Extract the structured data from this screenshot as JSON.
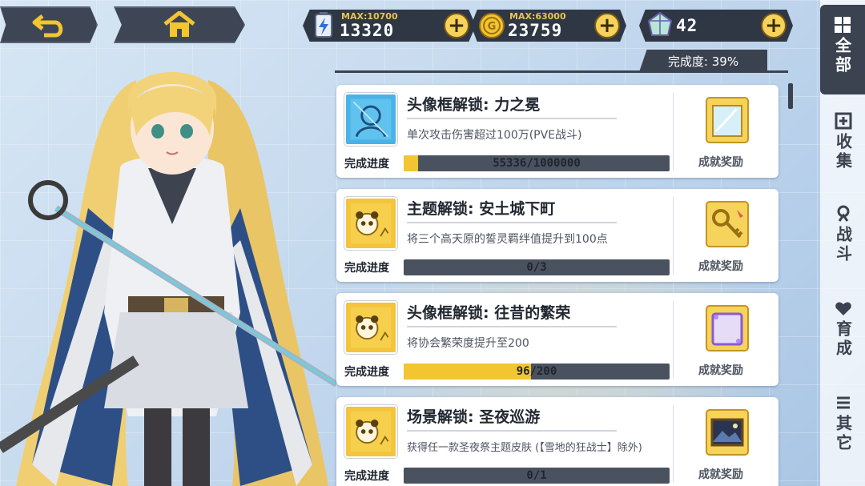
{
  "header": {
    "back_icon": "return-arrow-icon",
    "home_icon": "home-icon"
  },
  "resources": {
    "energy": {
      "icon": "energy-battery-icon",
      "max_label": "MAX:10700",
      "value": "13320"
    },
    "gold": {
      "icon": "gold-coin-icon",
      "max_label": "MAX:63000",
      "value": "23759"
    },
    "crystal": {
      "icon": "crystal-gem-icon",
      "value": "42"
    }
  },
  "completion": "完成度: 39%",
  "achievements": [
    {
      "title": "头像框解锁: 力之冕",
      "description": "单次攻击伤害超过100万(PVE战斗)",
      "progress_label": "完成进度",
      "progress_text": "55336/1000000",
      "progress_fraction": 0.055,
      "reward_label": "成就奖励",
      "icon": "avatar-portrait-icon",
      "reward_icon": "mirror-frame-icon"
    },
    {
      "title": "主题解锁: 安土城下町",
      "description": "将三个高天原的誓灵羁绊值提升到100点",
      "progress_label": "完成进度",
      "progress_text": "0/3",
      "progress_fraction": 0,
      "reward_label": "成就奖励",
      "icon": "panda-badge-icon",
      "reward_icon": "key-icon"
    },
    {
      "title": "头像框解锁: 往昔的繁荣",
      "description": "将协会繁荣度提升至200",
      "progress_label": "完成进度",
      "progress_text": "96/200",
      "progress_fraction": 0.48,
      "reward_label": "成就奖励",
      "icon": "panda-badge-icon",
      "reward_icon": "purple-frame-icon"
    },
    {
      "title": "场景解锁: 圣夜巡游",
      "description": "获得任一款圣夜祭主题皮肤 (【雪地的狂战士】除外)",
      "progress_label": "完成进度",
      "progress_text": "0/1",
      "progress_fraction": 0,
      "reward_label": "成就奖励",
      "icon": "panda-badge-icon",
      "reward_icon": "scene-picture-icon"
    }
  ],
  "tabs": [
    {
      "label": "全部",
      "icon": "grid-icon",
      "active": true
    },
    {
      "label": "收集",
      "icon": "collection-icon",
      "active": false
    },
    {
      "label": "战斗",
      "icon": "battle-icon",
      "active": false
    },
    {
      "label": "育成",
      "icon": "heart-icon",
      "active": false
    },
    {
      "label": "其它",
      "icon": "menu-lines-icon",
      "active": false
    }
  ],
  "colors": {
    "accent_gold": "#f2c531",
    "dark_panel": "#3b4350"
  }
}
